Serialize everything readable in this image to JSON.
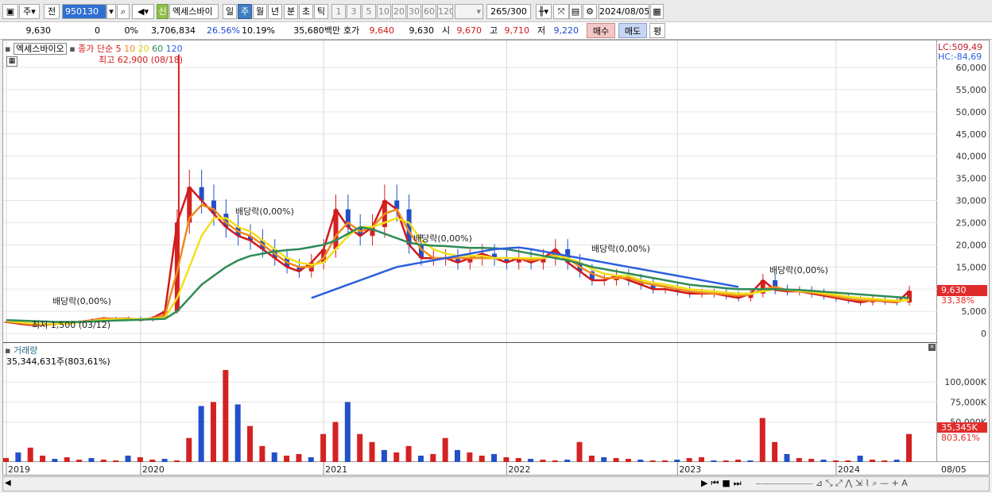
{
  "toolbar": {
    "period_select": "주",
    "jeon_label": "전",
    "code_value": "950130",
    "stock_name": "엑세스바이",
    "new_badge": "신",
    "tf_day": "일",
    "tf_week": "주",
    "tf_month": "월",
    "tf_year": "년",
    "tf_minute": "분",
    "tf_second": "초",
    "tf_tick": "틱",
    "intervals": [
      "1",
      "3",
      "5",
      "10",
      "20",
      "30",
      "60",
      "120"
    ],
    "count_value": "265",
    "count_total": "/300",
    "date_value": "2024/08/05"
  },
  "quote": {
    "price": "9,630",
    "change": "0",
    "change_pct": "0%",
    "volume": "3,706,834",
    "turnover_pct": "26.56%",
    "rate": "10.19%",
    "amount": "35,680백만",
    "bid_label": "호가",
    "bid_value": "9,640",
    "ask_value": "9,630",
    "open_label": "시",
    "open_value": "9,670",
    "high_label": "고",
    "high_value": "9,710",
    "low_label": "저",
    "low_value": "9,220",
    "buy_label": "매수",
    "sell_label": "매도",
    "avg_label": "평"
  },
  "legend": {
    "stock_name": "엑세스바이오",
    "ma_label": "종가 단순",
    "ma_periods": [
      "5",
      "10",
      "20",
      "60",
      "120"
    ],
    "ma_colors": [
      "#d11a1a",
      "#ef8a1c",
      "#f1e019",
      "#2e8b57",
      "#2c5fdc"
    ],
    "high_annotation": "최고 62,900 (08/18)",
    "low_annotation": "최저 1,500 (03/12)",
    "dividend_1": "배당락(0,00%)",
    "dividend_2": "배당락(0,00%)",
    "dividend_3": "배당락(0,00%)",
    "dividend_4": "배당락(0,00%)",
    "dividend_5": "배당락(0,00%)"
  },
  "right_axis": {
    "lc": "LC:509,49",
    "hc": "HC:-84,69",
    "current_price": "9,630",
    "current_pct": "33,38%",
    "volume_badge": "35,345K",
    "volume_pct": "803,61%"
  },
  "volume_panel": {
    "title": "거래량",
    "value": "35,344,631주(803,61%)"
  },
  "chart_data": {
    "type": "candlestick",
    "x_labels": [
      "2019",
      "2020",
      "2021",
      "2022",
      "2023",
      "2024",
      "08/05"
    ],
    "price_ticks": [
      "60,000",
      "55,000",
      "50,000",
      "45,000",
      "40,000",
      "35,000",
      "30,000",
      "25,000",
      "20,000",
      "15,000",
      "10,000",
      "5,000",
      "0"
    ],
    "volume_ticks": [
      "100,000K",
      "75,000K",
      "50,000K"
    ],
    "price_ylim": [
      0,
      60000
    ],
    "volume_ylim": [
      0,
      120000
    ],
    "series": [
      {
        "name": "5",
        "values": [
          2600,
          2200,
          1900,
          1900,
          2100,
          2400,
          2600,
          3000,
          3400,
          3300,
          3400,
          3000,
          3500,
          5000,
          25000,
          33000,
          30000,
          27000,
          24000,
          22000,
          21000,
          19000,
          17000,
          15000,
          14000,
          16000,
          19000,
          28000,
          24000,
          22000,
          24000,
          30000,
          28000,
          20000,
          17000,
          17000,
          17000,
          16000,
          17000,
          18000,
          17000,
          16000,
          17000,
          16000,
          17000,
          19000,
          16000,
          14000,
          12000,
          12000,
          13000,
          12000,
          11000,
          10000,
          10000,
          9500,
          9000,
          9000,
          9000,
          8500,
          8000,
          9000,
          12000,
          9800,
          9500,
          9500,
          9000,
          8500,
          8000,
          7500,
          7000,
          7500,
          7200,
          7000,
          9600
        ]
      },
      {
        "name": "10",
        "values": [
          2700,
          2400,
          2100,
          2000,
          2100,
          2300,
          2600,
          2900,
          3300,
          3300,
          3300,
          3200,
          3400,
          4200,
          14000,
          26000,
          29000,
          28000,
          25000,
          23000,
          22000,
          20000,
          18000,
          16000,
          15000,
          15000,
          17000,
          22000,
          25000,
          23000,
          24000,
          27000,
          28000,
          23000,
          19000,
          17000,
          17000,
          17000,
          17000,
          17000,
          17000,
          17000,
          17000,
          16500,
          17000,
          18000,
          17000,
          15000,
          13500,
          12500,
          12500,
          12500,
          11500,
          11000,
          10500,
          10000,
          9500,
          9200,
          9000,
          8800,
          8500,
          8800,
          10000,
          10500,
          9800,
          9500,
          9200,
          8800,
          8300,
          7800,
          7500,
          7400,
          7300,
          7100,
          7800
        ]
      },
      {
        "name": "20",
        "values": [
          2800,
          2600,
          2300,
          2100,
          2100,
          2200,
          2500,
          2800,
          3100,
          3200,
          3300,
          3200,
          3300,
          3600,
          8000,
          15000,
          22000,
          26000,
          26000,
          24000,
          23000,
          21000,
          19000,
          17000,
          16000,
          15500,
          16000,
          19000,
          22000,
          24000,
          24000,
          25000,
          26000,
          25000,
          21000,
          19000,
          18000,
          17500,
          17500,
          17500,
          17000,
          17000,
          17000,
          17000,
          17000,
          17500,
          17000,
          16000,
          14500,
          13500,
          13000,
          13000,
          12000,
          11500,
          11000,
          10500,
          10000,
          9700,
          9500,
          9200,
          9000,
          9000,
          9500,
          10000,
          9800,
          9600,
          9400,
          9000,
          8700,
          8300,
          8000,
          7800,
          7600,
          7400,
          7500
        ]
      },
      {
        "name": "60",
        "values": [
          3000,
          2900,
          2800,
          2700,
          2600,
          2600,
          2600,
          2700,
          2800,
          2900,
          3000,
          3100,
          3200,
          3300,
          5000,
          8000,
          11000,
          13000,
          15000,
          16500,
          17500,
          18000,
          18500,
          18800,
          19000,
          19500,
          20000,
          21000,
          22500,
          24000,
          23500,
          22500,
          21500,
          20500,
          20000,
          19800,
          19700,
          19500,
          19300,
          19300,
          19200,
          19000,
          18500,
          18000,
          17500,
          17000,
          16500,
          15800,
          15000,
          14500,
          14000,
          13500,
          13000,
          12500,
          12000,
          11500,
          11000,
          10700,
          10500,
          10200,
          10000,
          10000,
          10000,
          10000,
          9900,
          9800,
          9600,
          9400,
          9200,
          9000,
          8800,
          8600,
          8400,
          8200,
          8000
        ]
      },
      {
        "name": "120",
        "values": [
          null,
          null,
          null,
          null,
          null,
          null,
          null,
          null,
          null,
          null,
          null,
          null,
          null,
          null,
          null,
          null,
          null,
          null,
          null,
          null,
          null,
          null,
          null,
          null,
          null,
          8000,
          9000,
          10000,
          11000,
          12000,
          13000,
          14000,
          15000,
          15500,
          16000,
          16500,
          17000,
          17500,
          18000,
          18500,
          19000,
          19200,
          19400,
          19000,
          18500,
          18000,
          17500,
          17000,
          16500,
          16000,
          15500,
          15000,
          14500,
          14000,
          13500,
          13000,
          12500,
          12000,
          11500,
          11000,
          10500,
          null,
          null,
          null,
          null,
          null,
          null,
          null,
          null,
          null,
          null,
          null,
          null,
          null,
          null
        ]
      }
    ],
    "volumes": [
      5000,
      12000,
      18000,
      8000,
      4000,
      6000,
      3000,
      5000,
      3000,
      2000,
      8000,
      6000,
      3000,
      4000,
      2000,
      30000,
      70000,
      75000,
      115000,
      72000,
      45000,
      20000,
      12000,
      8000,
      10000,
      6000,
      35000,
      50000,
      75000,
      35000,
      25000,
      15000,
      12000,
      20000,
      8000,
      10000,
      30000,
      15000,
      12000,
      8000,
      10000,
      6000,
      5000,
      4000,
      3000,
      2000,
      3000,
      25000,
      8000,
      6000,
      5000,
      4000,
      3000,
      2000,
      2000,
      3000,
      5000,
      6000,
      2000,
      2000,
      3000,
      2000,
      55000,
      25000,
      10000,
      5000,
      4000,
      3000,
      2000,
      2000,
      8000,
      3000,
      2000,
      3000,
      35000
    ]
  }
}
